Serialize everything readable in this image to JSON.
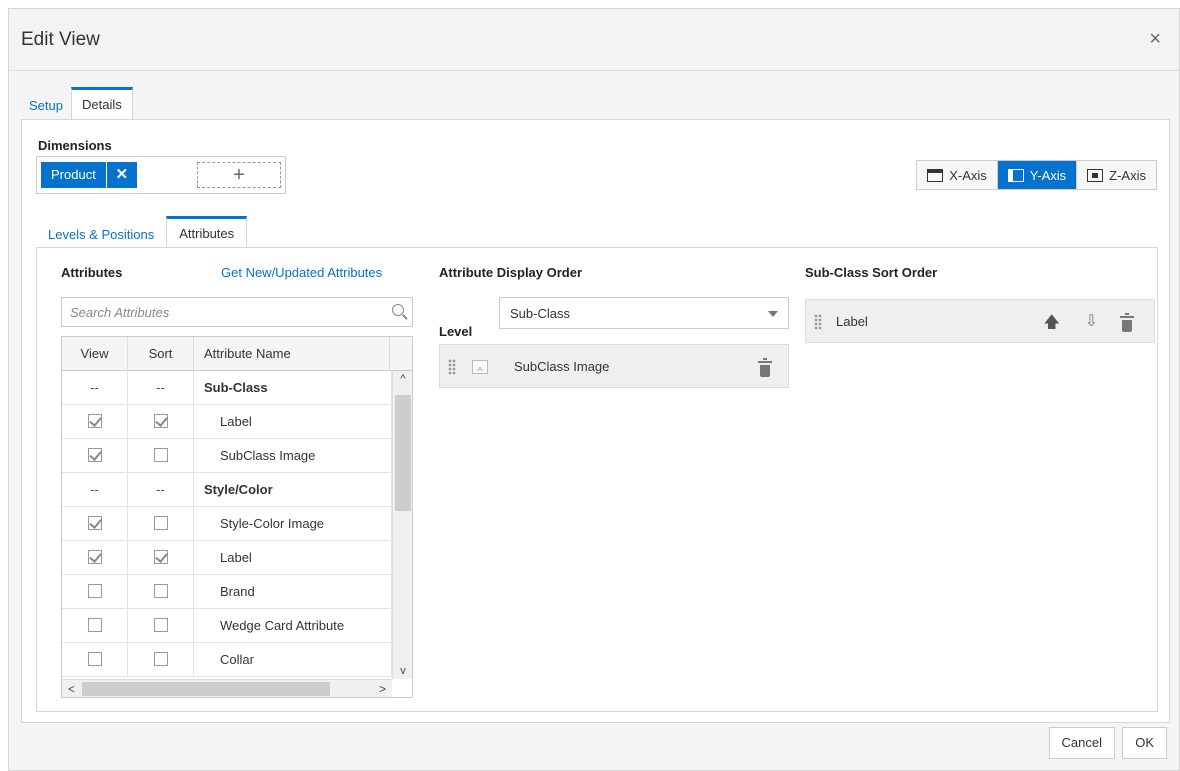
{
  "dialog": {
    "title": "Edit View",
    "close_glyph": "×",
    "tabs": [
      {
        "label": "Setup",
        "active": false
      },
      {
        "label": "Details",
        "active": true
      }
    ]
  },
  "dimensions": {
    "label": "Dimensions",
    "chip_label": "Product",
    "chip_remove_glyph": "✕",
    "add_glyph": "+"
  },
  "axis_buttons": [
    {
      "label": "X-Axis",
      "icon": "x-axis-icon",
      "active": false
    },
    {
      "label": "Y-Axis",
      "icon": "y-axis-icon",
      "active": true
    },
    {
      "label": "Z-Axis",
      "icon": "z-axis-icon",
      "active": false
    }
  ],
  "inner_tabs": [
    {
      "label": "Levels & Positions",
      "active": false
    },
    {
      "label": "Attributes",
      "active": true
    }
  ],
  "attributes": {
    "title": "Attributes",
    "link": "Get New/Updated Attributes",
    "search_placeholder": "Search Attributes",
    "columns": [
      "View",
      "Sort",
      "Attribute Name"
    ],
    "rows": [
      {
        "view": "--",
        "sort": "--",
        "name": "Sub-Class",
        "group": true
      },
      {
        "view": true,
        "sort": true,
        "name": "Label",
        "group": false
      },
      {
        "view": true,
        "sort": false,
        "name": "SubClass Image",
        "group": false
      },
      {
        "view": "--",
        "sort": "--",
        "name": "Style/Color",
        "group": true
      },
      {
        "view": true,
        "sort": false,
        "name": "Style-Color Image",
        "group": false
      },
      {
        "view": true,
        "sort": true,
        "name": "Label",
        "group": false
      },
      {
        "view": false,
        "sort": false,
        "name": "Brand",
        "group": false
      },
      {
        "view": false,
        "sort": false,
        "name": "Wedge Card Attribute",
        "group": false
      },
      {
        "view": false,
        "sort": false,
        "name": "Collar",
        "group": false
      }
    ],
    "scroll_up": "^",
    "scroll_down": "v",
    "scroll_left": "<",
    "scroll_right": ">"
  },
  "display_order": {
    "title": "Attribute Display Order",
    "level_label": "Level",
    "level_value": "Sub-Class",
    "items": [
      {
        "label": "SubClass Image"
      }
    ]
  },
  "sort_order": {
    "title": "Sub-Class Sort Order",
    "items": [
      {
        "label": "Label"
      }
    ]
  },
  "footer": {
    "cancel": "Cancel",
    "ok": "OK"
  },
  "colors": {
    "accent": "#0572ce",
    "panel_bg": "#f5f5f5"
  }
}
